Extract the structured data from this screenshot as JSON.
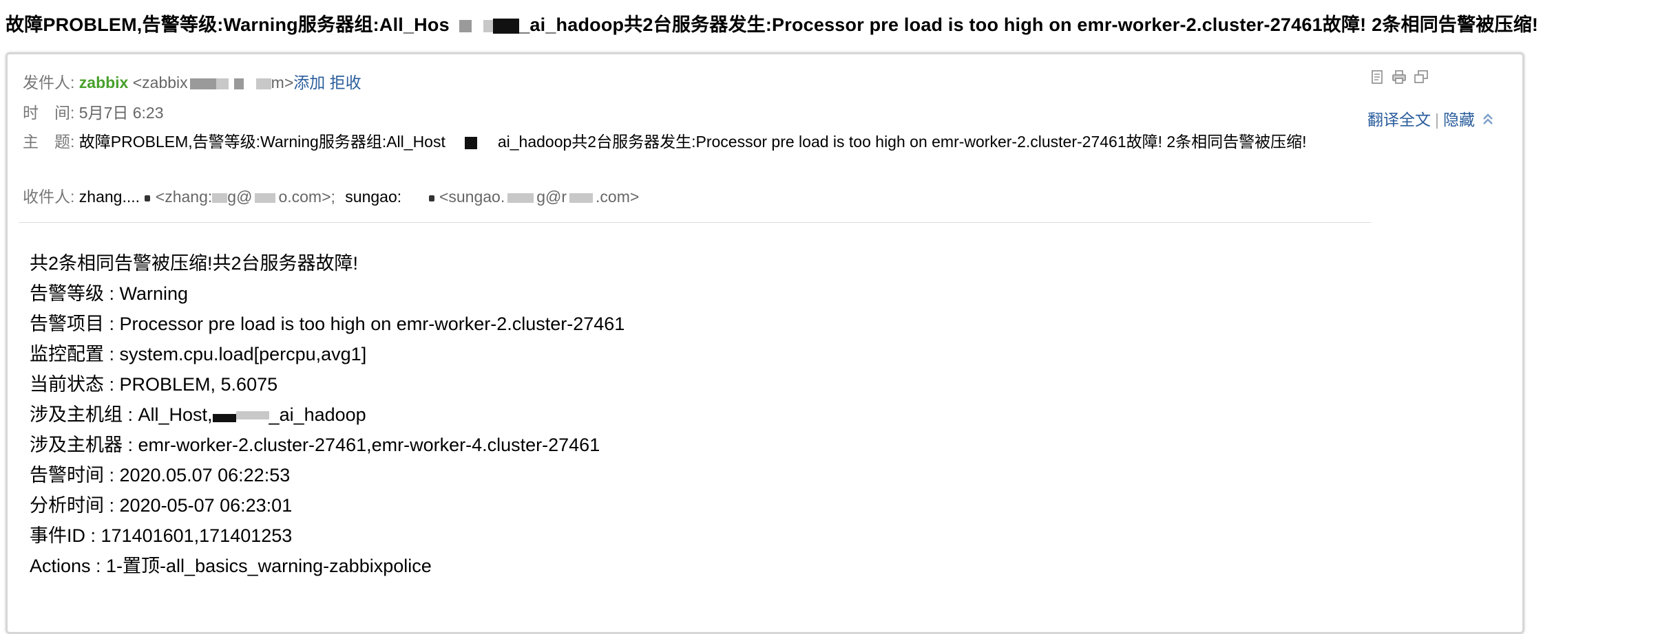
{
  "page_title": "故障PROBLEM,告警等级:Warning服务器组:All_Hos",
  "page_title_tail": "_ai_hadoop共2台服务器发生:Processor pre load is too high on emr-worker-2.cluster-27461故障! 2条相同告警被压缩!",
  "header": {
    "from_label": "发件人:",
    "sender_name": "zabbix",
    "sender_addr_start": "<zabbix",
    "sender_addr_end": "m>",
    "add_label": "添加",
    "reject_label": "拒收",
    "time_label": "时　间:",
    "time_value": "5月7日 6:23",
    "subject_label": "主　题:",
    "subject_part1": "故障PROBLEM,告警等级:Warning服务器组:All_Host",
    "subject_part2": "ai_hadoop共2台服务器发生:Processor pre load is too high on emr-worker-2.cluster-27461故障! 2条相同告警被压缩!",
    "to_label": "收件人:",
    "recipients": [
      {
        "name": "zhang....",
        "addr_start": "<zhang:",
        "addr_mid": "g@",
        "addr_end": "o.com>;"
      },
      {
        "name": "sungao:",
        "addr_start": "<sungao.",
        "addr_mid": "g@r",
        "addr_end": ".com>"
      }
    ]
  },
  "actions": {
    "translate_label": "翻译全文",
    "separator": "|",
    "hide_label": "隐藏",
    "hide_icon": "double-chevron-up-icon"
  },
  "toolbar_icons": [
    "document-icon",
    "print-icon",
    "new-window-icon"
  ],
  "body": [
    "共2条相同告警被压缩!共2台服务器故障!",
    "告警等级 : Warning",
    "告警项目 : Processor pre load is too high on emr-worker-2.cluster-27461",
    "监控配置 : system.cpu.load[percpu,avg1]",
    "当前状态 : PROBLEM, 5.6075",
    "涉及主机组 : All_Host,",
    "涉及主机器 : emr-worker-2.cluster-27461,emr-worker-4.cluster-27461",
    "告警时间 : 2020.05.07 06:22:53",
    "分析时间 : 2020-05-07 06:23:01",
    "事件ID : 171401601,171401253",
    "Actions : 1-置顶-all_basics_warning-zabbixpolice"
  ],
  "body_hostgroup_tail": "_ai_hadoop",
  "colors": {
    "sender_green": "#48a12c",
    "link_blue": "#2a5d9c",
    "label_grey": "#777777"
  }
}
